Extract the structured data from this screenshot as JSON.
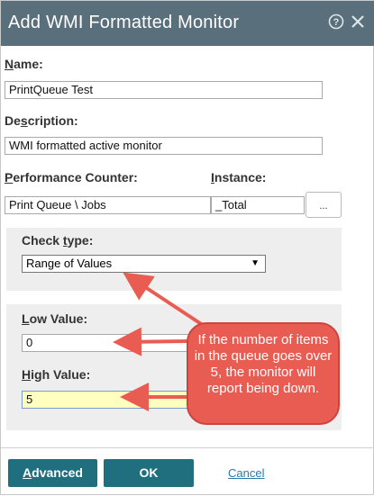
{
  "dialog": {
    "title": "Add WMI Formatted Monitor",
    "help_icon": "help-icon",
    "close_icon": "close-icon"
  },
  "name": {
    "label_u": "N",
    "label_rest": "ame:",
    "value": "PrintQueue Test"
  },
  "description": {
    "label_pre": "De",
    "label_u": "s",
    "label_rest": "cription:",
    "value": "WMI formatted active monitor"
  },
  "performance_counter": {
    "label_u": "P",
    "label_rest": "erformance Counter:",
    "value": "Print Queue \\ Jobs"
  },
  "instance": {
    "label_u": "I",
    "label_rest": "nstance:",
    "value": "_Total",
    "browse_label": "..."
  },
  "check_type": {
    "label_pre": "Check ",
    "label_u": "t",
    "label_rest": "ype:",
    "selected": "Range of Values"
  },
  "low_value": {
    "label_u": "L",
    "label_rest": "ow Value:",
    "value": "0"
  },
  "high_value": {
    "label_u": "H",
    "label_rest": "igh Value:",
    "value": "5"
  },
  "callout": {
    "text": "If the number of items in the queue goes over 5, the monitor will report being down."
  },
  "footer": {
    "advanced_u": "A",
    "advanced_rest": "dvanced",
    "ok_label": "OK",
    "cancel_label": "Cancel"
  },
  "colors": {
    "titlebar": "#5a6f7c",
    "button": "#1f6f7f",
    "callout": "#e85c52",
    "highlight": "#ffffc0"
  }
}
